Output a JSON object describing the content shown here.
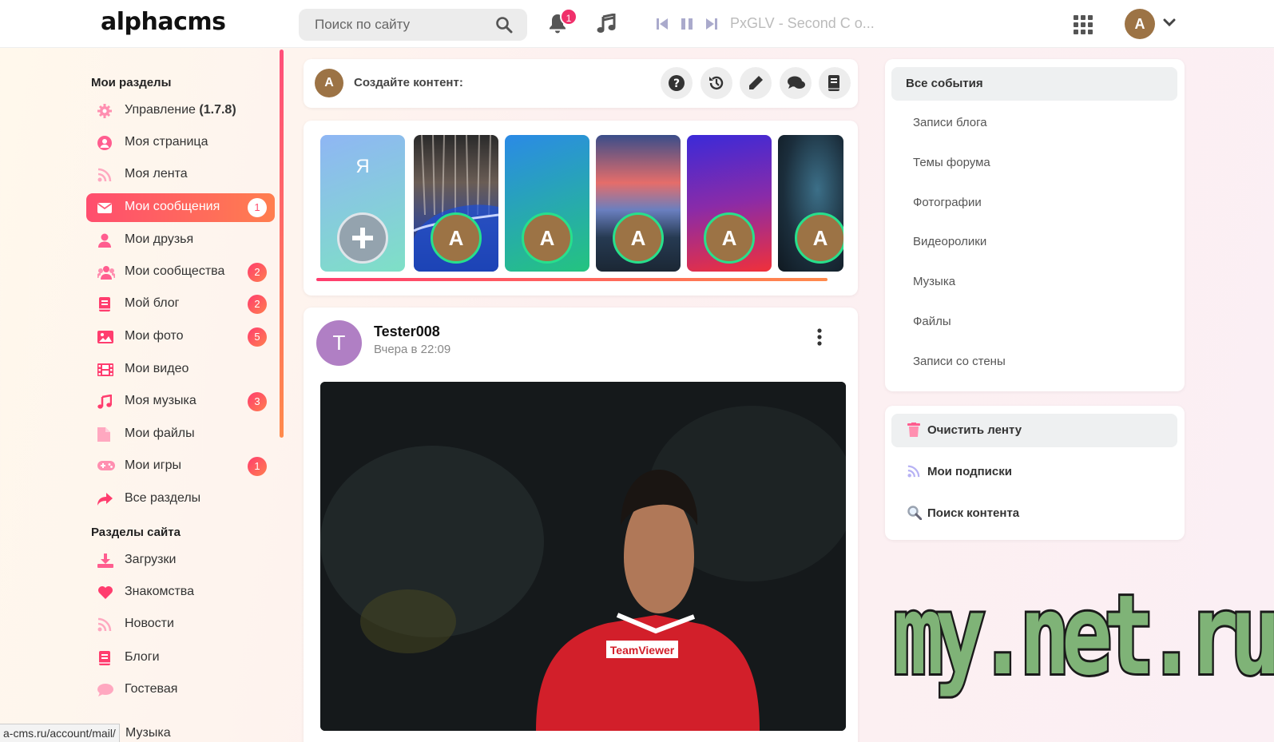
{
  "header": {
    "logo": "alphacms",
    "search_placeholder": "Поиск по сайту",
    "notifications_count": "1",
    "track_title": "PxGLV - Second C o...",
    "avatar_letter": "A",
    "icons": [
      "search-icon",
      "bell-icon",
      "music-note-icon",
      "skip-back-icon",
      "pause-icon",
      "skip-forward-icon",
      "apps-grid-icon",
      "chevron-down-icon"
    ]
  },
  "sidebar": {
    "section1_title": "Мои разделы",
    "items": [
      {
        "label": "Управление",
        "version": "(1.7.8)",
        "icon": "gear-icon",
        "badge": "",
        "color": "#ff5d8f"
      },
      {
        "label": "Моя страница",
        "icon": "user-circle-icon",
        "badge": "",
        "color": "#ff5d8f"
      },
      {
        "label": "Моя лента",
        "icon": "rss-icon",
        "badge": "",
        "color": "#ff8fb0"
      },
      {
        "label": "Мои сообщения",
        "icon": "mail-icon",
        "badge": "1",
        "color": "#ffffff"
      },
      {
        "label": "Мои друзья",
        "icon": "user-icon",
        "badge": "",
        "color": "#ff5d8f"
      },
      {
        "label": "Мои сообщества",
        "icon": "users-icon",
        "badge": "2",
        "color": "#ff5d8f"
      },
      {
        "label": "Мой блог",
        "icon": "book-icon",
        "badge": "2",
        "color": "#ff3d6e"
      },
      {
        "label": "Мои фото",
        "icon": "image-icon",
        "badge": "5",
        "color": "#ff3d6e"
      },
      {
        "label": "Мои видео",
        "icon": "film-icon",
        "badge": "",
        "color": "#ff3d6e"
      },
      {
        "label": "Моя музыка",
        "icon": "music-icon",
        "badge": "3",
        "color": "#ff3d6e"
      },
      {
        "label": "Мои файлы",
        "icon": "file-icon",
        "badge": "",
        "color": "#ff8fb0"
      },
      {
        "label": "Мои игры",
        "icon": "gamepad-icon",
        "badge": "1",
        "color": "#ff5d8f"
      },
      {
        "label": "Все разделы",
        "icon": "share-icon",
        "badge": "",
        "color": "#ff3d6e"
      }
    ],
    "section2_title": "Разделы сайта",
    "site_items": [
      {
        "label": "Загрузки",
        "icon": "download-icon",
        "color": "#ff5d8f"
      },
      {
        "label": "Знакомства",
        "icon": "heart-icon",
        "color": "#ff3d6e"
      },
      {
        "label": "Новости",
        "icon": "rss-icon",
        "color": "#ff8fb0"
      },
      {
        "label": "Блоги",
        "icon": "book-icon",
        "color": "#ff3d6e"
      },
      {
        "label": "Гостевая",
        "icon": "comment-icon",
        "color": "#ff8fb0"
      },
      {
        "label": "Музыка",
        "icon": "music-icon",
        "color": "#ff3d6e"
      }
    ]
  },
  "create": {
    "avatar_letter": "A",
    "label": "Создайте контент:",
    "buttons": [
      "question-icon",
      "history-icon",
      "pencil-icon",
      "comments-icon",
      "book-icon"
    ]
  },
  "stories": {
    "me_label": "Я",
    "avatar_letter": "A"
  },
  "post": {
    "avatar_letter": "T",
    "author": "Tester008",
    "time": "Вчера в 22:09"
  },
  "events": {
    "head": "Все события",
    "items": [
      "Записи блога",
      "Темы форума",
      "Фотографии",
      "Видеоролики",
      "Музыка",
      "Файлы",
      "Записи со стены"
    ]
  },
  "tools": [
    {
      "label": "Очистить ленту",
      "icon": "trash-icon"
    },
    {
      "label": "Мои подписки",
      "icon": "rss-icon"
    },
    {
      "label": "Поиск контента",
      "icon": "search-icon"
    }
  ],
  "statusbar": {
    "url": "a-cms.ru/account/mail/"
  },
  "watermark": "my.net.ru",
  "colors": {
    "accent_start": "#ff4d6e",
    "accent_end": "#ff7e4f",
    "avatar_brown": "#9c7345",
    "story_ring": "#27e08c"
  }
}
